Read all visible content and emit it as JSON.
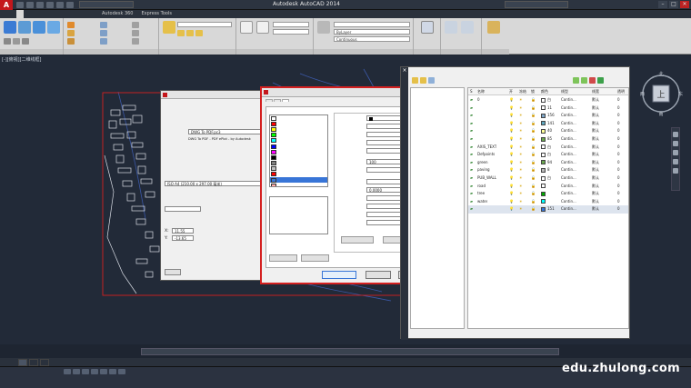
{
  "window": {
    "title": "Autodesk AutoCAD 2014",
    "app_logo": "A",
    "workspace": "",
    "controls": [
      "–",
      "□",
      "✕"
    ]
  },
  "ribbon": {
    "tabs": [
      "",
      "",
      "",
      "",
      "",
      "",
      "",
      "",
      "",
      "",
      "Autodesk 360",
      "Express Tools",
      ""
    ],
    "active_tab": 0,
    "bylayer_label": "ByLayer",
    "continuous_label": "Continuous"
  },
  "viewport": {
    "label": "[-][俯视][二维线框]"
  },
  "plot_dialog": {
    "title": "",
    "rows": [
      {
        "text": ""
      },
      {
        "text": ""
      },
      {
        "text": ""
      },
      {
        "text": ""
      },
      {
        "text": ""
      },
      {
        "text": ""
      },
      {
        "text": ""
      },
      {
        "text": ""
      },
      {
        "text": ""
      },
      {
        "text": ""
      },
      {
        "text": ""
      },
      {
        "text": ""
      },
      {
        "text": ""
      },
      {
        "text": ""
      }
    ],
    "fields": {
      "printer": "DWG To PDF.pc3",
      "plotter": "DWG To PDF - PDF ePlot - by Autodesk",
      "paper": "ISO A4 (210.00 x 297.00 毫米)",
      "offset_x": "11.55",
      "offset_y": "-13.65",
      "display": ""
    },
    "buttons": {
      "properties": "",
      "preview": ""
    }
  },
  "plot_style_editor": {
    "title": "",
    "tabs": [
      "",
      "",
      ""
    ],
    "active_tab": 2,
    "styles_label": "",
    "styles": [
      {
        "name": "",
        "color": "#ffffff"
      },
      {
        "name": "",
        "color": "#ff0000"
      },
      {
        "name": "",
        "color": "#ffff00"
      },
      {
        "name": "",
        "color": "#00ff00"
      },
      {
        "name": "",
        "color": "#00ffff"
      },
      {
        "name": "",
        "color": "#0000ff"
      },
      {
        "name": "",
        "color": "#ff00ff"
      },
      {
        "name": "",
        "color": "#000000"
      },
      {
        "name": "",
        "color": "#808080"
      },
      {
        "name": "",
        "color": "#c0c0c0"
      },
      {
        "name": "",
        "color": "#ff0000"
      },
      {
        "name": "",
        "color": "#3875d7"
      },
      {
        "name": "",
        "color": "#ffaaaa"
      }
    ],
    "selected_style": 11,
    "description_label": "",
    "buttons": {
      "add_style": "",
      "delete_style": "",
      "edit_lineweights": "",
      "save_as": "",
      "save_close": "",
      "cancel": "",
      "help": ""
    },
    "properties_label": "",
    "properties": [
      {
        "label": "",
        "value": ""
      },
      {
        "label": "",
        "value": ""
      },
      {
        "label": "",
        "value": ""
      },
      {
        "label": "",
        "value": ""
      },
      {
        "label": "",
        "value": ""
      },
      {
        "label": "",
        "value": "100"
      },
      {
        "label": "",
        "value": ""
      },
      {
        "label": "",
        "value": ""
      },
      {
        "label": "",
        "value": "0.0000"
      },
      {
        "label": "",
        "value": ""
      },
      {
        "label": "",
        "value": ""
      },
      {
        "label": "",
        "value": ""
      },
      {
        "label": "",
        "value": ""
      }
    ]
  },
  "layer_palette": {
    "header": "",
    "tree": [
      {
        "name": ""
      },
      {
        "name": ""
      },
      {
        "name": ""
      }
    ],
    "invert_filter": "",
    "columns": [
      "S",
      "名称",
      "开",
      "冻结",
      "锁",
      "颜色",
      "线型",
      "线宽",
      "透明"
    ],
    "rows": [
      {
        "name": "0",
        "color": "#ffffff",
        "color_label": "白",
        "linetype": "Contin...",
        "lineweight": "默认",
        "transparency": "0"
      },
      {
        "name": "",
        "color": "#ffffff",
        "color_label": "11",
        "linetype": "Contin...",
        "lineweight": "默认",
        "transparency": "0"
      },
      {
        "name": "",
        "color": "#7fa6c8",
        "color_label": "156",
        "linetype": "Contin...",
        "lineweight": "默认",
        "transparency": "0"
      },
      {
        "name": "",
        "color": "#5fa8c0",
        "color_label": "141",
        "linetype": "Contin...",
        "lineweight": "默认",
        "transparency": "0"
      },
      {
        "name": "",
        "color": "#ffff99",
        "color_label": "40",
        "linetype": "Contin...",
        "lineweight": "默认",
        "transparency": "0"
      },
      {
        "name": "",
        "color": "#6aa84f",
        "color_label": "85",
        "linetype": "Contin...",
        "lineweight": "默认",
        "transparency": "0"
      },
      {
        "name": "AXIS_TEXT",
        "color": "#ffffff",
        "color_label": "白",
        "linetype": "Contin...",
        "lineweight": "默认",
        "transparency": "0"
      },
      {
        "name": "Defpoints",
        "color": "#ffffff",
        "color_label": "白",
        "linetype": "Contin...",
        "lineweight": "默认",
        "transparency": "0"
      },
      {
        "name": "green",
        "color": "#6aa84f",
        "color_label": "94",
        "linetype": "Contin...",
        "lineweight": "默认",
        "transparency": "0"
      },
      {
        "name": "paving",
        "color": "#bbbbbb",
        "color_label": "8",
        "linetype": "Contin...",
        "lineweight": "默认",
        "transparency": "0"
      },
      {
        "name": "PUB_WALL",
        "color": "#ffffff",
        "color_label": "白",
        "linetype": "Contin...",
        "lineweight": "默认",
        "transparency": "0"
      },
      {
        "name": "road",
        "color": "#ffffff",
        "color_label": "",
        "linetype": "Contin...",
        "lineweight": "默认",
        "transparency": "0"
      },
      {
        "name": "tree",
        "color": "#00aa00",
        "color_label": "",
        "linetype": "Contin...",
        "lineweight": "默认",
        "transparency": "0"
      },
      {
        "name": "water",
        "color": "#00ffff",
        "color_label": "",
        "linetype": "Contin...",
        "lineweight": "默认",
        "transparency": "0"
      },
      {
        "name": "",
        "color": "#3875d7",
        "color_label": "151",
        "linetype": "Contin...",
        "lineweight": "默认",
        "transparency": "0"
      }
    ],
    "selected_row": 14,
    "footer": ""
  },
  "command_line": {
    "text": ""
  },
  "layout_tabs": [
    "",
    "",
    ""
  ],
  "active_layout": 0,
  "statusbar": {
    "coords": ""
  },
  "watermark": "edu.zhulong.com"
}
